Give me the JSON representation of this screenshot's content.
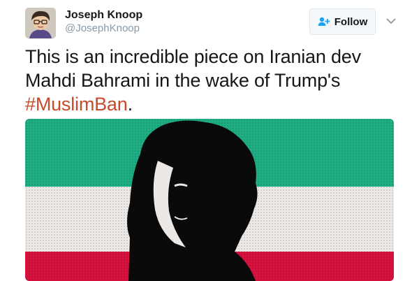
{
  "tweet": {
    "author": {
      "display_name": "Joseph Knoop",
      "handle": "@JosephKnoop"
    },
    "follow_button": {
      "label": "Follow",
      "icon": "add-person-icon"
    },
    "menu_icon": "chevron-down-icon",
    "text": {
      "line1": "This is an incredible piece on Iranian dev",
      "line2": "Mahdi Bahrami in the wake of Trump's",
      "hashtag": "#MuslimBan",
      "trailing": "."
    },
    "media": {
      "description_colors": {
        "top_band": "#1fae84",
        "middle_band": "#ece8e6",
        "bottom_band": "#d8123e",
        "silhouette": "#0a0a0a"
      }
    }
  }
}
